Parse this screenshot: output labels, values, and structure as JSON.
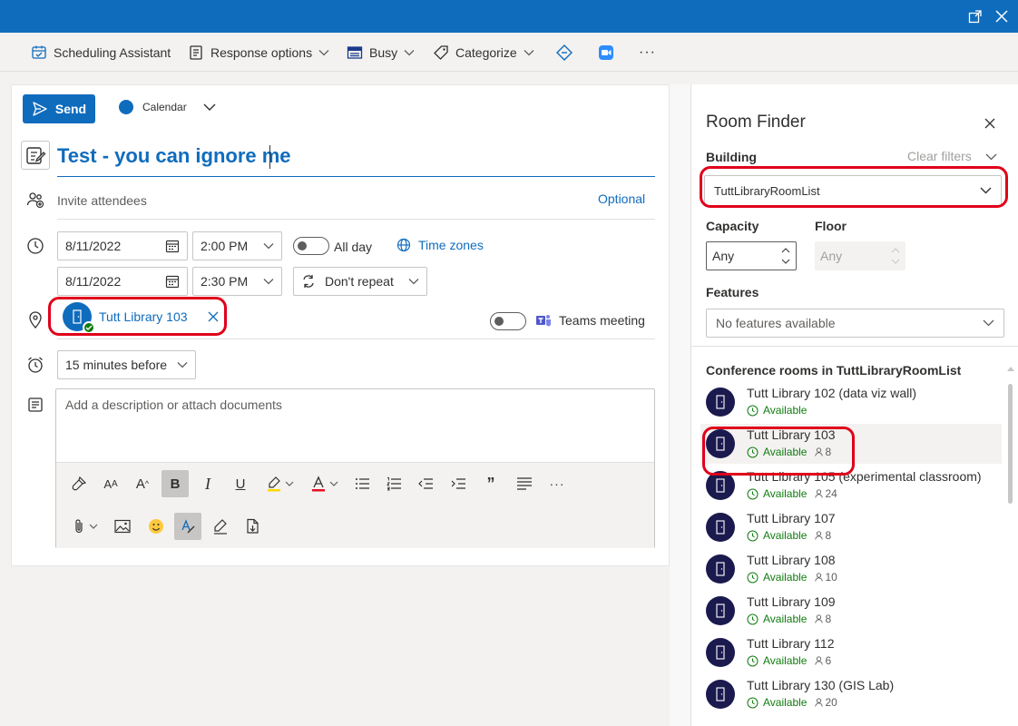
{
  "ribbon": {
    "scheduling_assistant": "Scheduling Assistant",
    "response_options": "Response options",
    "busy": "Busy",
    "categorize": "Categorize",
    "more": "···"
  },
  "compose": {
    "send_label": "Send",
    "calendar_label": "Calendar",
    "title": "Test - you can ignore me",
    "attendees_placeholder": "Invite attendees",
    "optional_label": "Optional",
    "start_date": "8/11/2022",
    "start_time": "2:00 PM",
    "end_date": "8/11/2022",
    "end_time": "2:30 PM",
    "all_day_label": "All day",
    "time_zones_label": "Time zones",
    "repeat_label": "Don't repeat",
    "location": "Tutt Library 103",
    "teams_label": "Teams meeting",
    "reminder": "15 minutes before",
    "description_placeholder": "Add a description or attach documents"
  },
  "room_finder": {
    "title": "Room Finder",
    "building_label": "Building",
    "clear_filters": "Clear filters",
    "building_value": "TuttLibraryRoomList",
    "capacity_label": "Capacity",
    "capacity_value": "Any",
    "floor_label": "Floor",
    "floor_value": "Any",
    "features_label": "Features",
    "features_value": "No features available",
    "section_title": "Conference rooms in TuttLibraryRoomList",
    "rooms": [
      {
        "name": "Tutt Library 102 (data viz wall)",
        "status": "Available",
        "capacity": ""
      },
      {
        "name": "Tutt Library 103",
        "status": "Available",
        "capacity": "8"
      },
      {
        "name": "Tutt Library 105 (experimental classroom)",
        "status": "Available",
        "capacity": "24"
      },
      {
        "name": "Tutt Library 107",
        "status": "Available",
        "capacity": "8"
      },
      {
        "name": "Tutt Library 108",
        "status": "Available",
        "capacity": "10"
      },
      {
        "name": "Tutt Library 109",
        "status": "Available",
        "capacity": "8"
      },
      {
        "name": "Tutt Library 112",
        "status": "Available",
        "capacity": "6"
      },
      {
        "name": "Tutt Library 130 (GIS Lab)",
        "status": "Available",
        "capacity": "20"
      }
    ]
  },
  "colors": {
    "brand": "#0f6cbd",
    "available": "#107c10",
    "highlight_ring": "#e0001a"
  }
}
